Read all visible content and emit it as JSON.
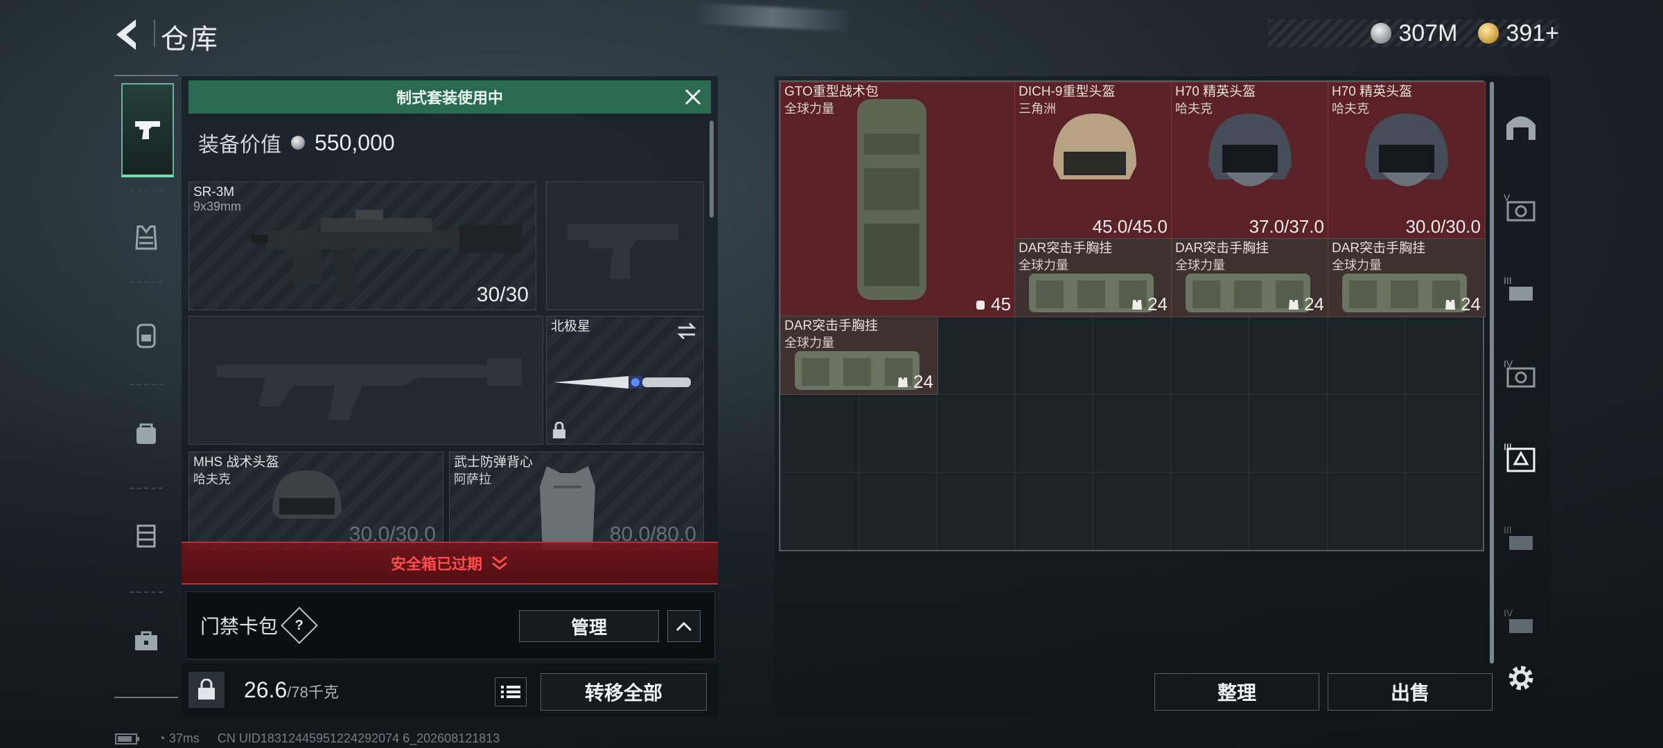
{
  "header": {
    "title": "仓库"
  },
  "currency": {
    "coins": "307M",
    "tickets": "391+"
  },
  "equipment": {
    "banner": "制式套装使用中",
    "value_label": "装备价值",
    "value": "550,000",
    "primary": {
      "name": "SR-3M",
      "caliber": "9x39mm",
      "ammo": "30/30"
    },
    "melee": {
      "name": "北极星"
    },
    "helmet": {
      "name": "MHS 战术头盔",
      "maker": "哈夫克",
      "durability": "30.0/30.0"
    },
    "armor": {
      "name": "武士防弹背心",
      "maker": "阿萨拉",
      "durability": "80.0/80.0"
    },
    "expired": "安全箱已过期",
    "keycard_label": "门禁卡包",
    "help": "?",
    "manage": "管理",
    "weight": "26.6",
    "weight_max": "/78千克",
    "transfer": "转移全部"
  },
  "storage": {
    "items": [
      {
        "name": "GTO重型战术包",
        "sub": "全球力量",
        "value": "45",
        "color": "red"
      },
      {
        "name": "DICH-9重型头盔",
        "sub": "三角洲",
        "value": "45.0/45.0",
        "color": "red"
      },
      {
        "name": "H70 精英头盔",
        "sub": "哈夫克",
        "value": "37.0/37.0",
        "color": "red"
      },
      {
        "name": "H70 精英头盔",
        "sub": "哈夫克",
        "value": "30.0/30.0",
        "color": "red"
      },
      {
        "name": "DAR突击手胸挂",
        "sub": "全球力量",
        "value": "24",
        "color": "brown"
      },
      {
        "name": "DAR突击手胸挂",
        "sub": "全球力量",
        "value": "24",
        "color": "brown"
      },
      {
        "name": "DAR突击手胸挂",
        "sub": "全球力量",
        "value": "24",
        "color": "brown"
      },
      {
        "name": "DAR突击手胸挂",
        "sub": "全球力量",
        "value": "24",
        "color": "brown"
      }
    ],
    "sort": "整理",
    "sell": "出售"
  },
  "status": {
    "ping": "37ms",
    "uid": "CN UID18312445951224292074 6_202608121813"
  },
  "icons": [
    "back-icon",
    "silver-coin-icon",
    "gold-coin-icon",
    "pistol-icon",
    "vest-icon",
    "backpack-icon",
    "bag-icon",
    "case-icon",
    "toolbox-icon",
    "close-icon",
    "swap-icon",
    "lock-icon",
    "list-icon",
    "chevron-up-icon",
    "chevron-down-icon",
    "settings-icon"
  ]
}
